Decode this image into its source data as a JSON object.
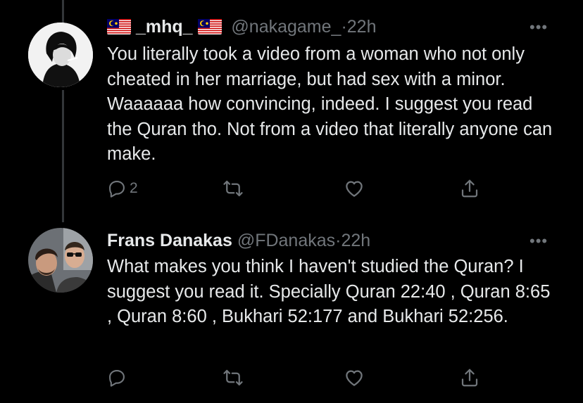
{
  "tweets": [
    {
      "name": "_mhq_",
      "handle": "@nakagame_",
      "separator": "·",
      "time": "22h",
      "text": "You literally took a video from a woman who not only cheated in her marriage, but had sex with a minor. Waaaaaa how convincing, indeed. I suggest you read the Quran tho. Not from a video that literally anyone can make.",
      "reply_count": "2",
      "more": "•••",
      "icons": [
        "malaysia-flag-icon",
        "reply-icon",
        "retweet-icon",
        "like-icon",
        "share-icon",
        "more-icon"
      ]
    },
    {
      "name": "Frans Danakas",
      "handle": "@FDanakas",
      "separator": "·",
      "time": "22h",
      "text": "What makes you think I haven't studied the Quran? I suggest you read it. Specially Quran 22:40 , Quran 8:65 , Quran 8:60 , Bukhari 52:177 and Bukhari 52:256.",
      "more": "•••",
      "icons": [
        "reply-icon",
        "retweet-icon",
        "like-icon",
        "share-icon",
        "more-icon"
      ]
    }
  ],
  "colors": {
    "background": "#000000",
    "text": "#e7e9ea",
    "muted": "#71767b",
    "flag_red": "#cc0001",
    "flag_blue": "#010066",
    "flag_yellow": "#ffcc00"
  }
}
